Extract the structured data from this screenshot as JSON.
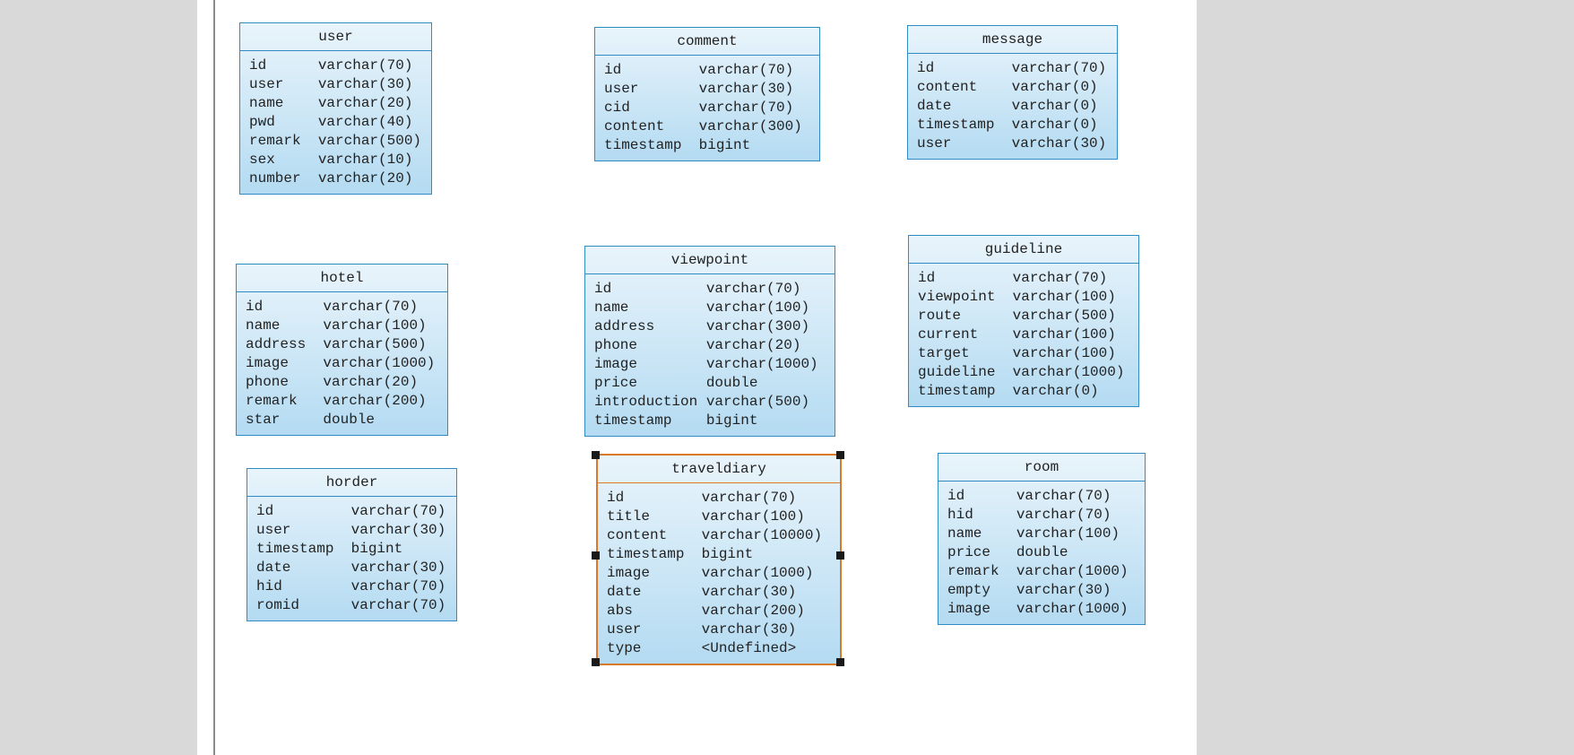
{
  "entities": {
    "user": {
      "title": "user",
      "nameW": 8,
      "rows": [
        {
          "name": "id",
          "type": "varchar(70)"
        },
        {
          "name": "user",
          "type": "varchar(30)"
        },
        {
          "name": "name",
          "type": "varchar(20)"
        },
        {
          "name": "pwd",
          "type": "varchar(40)"
        },
        {
          "name": "remark",
          "type": "varchar(500)"
        },
        {
          "name": "sex",
          "type": "varchar(10)"
        },
        {
          "name": "number",
          "type": "varchar(20)"
        }
      ]
    },
    "comment": {
      "title": "comment",
      "nameW": 11,
      "rows": [
        {
          "name": "id",
          "type": "varchar(70)"
        },
        {
          "name": "user",
          "type": "varchar(30)"
        },
        {
          "name": "cid",
          "type": "varchar(70)"
        },
        {
          "name": "content",
          "type": "varchar(300)"
        },
        {
          "name": "timestamp",
          "type": "bigint"
        }
      ]
    },
    "message": {
      "title": "message",
      "nameW": 11,
      "rows": [
        {
          "name": "id",
          "type": "varchar(70)"
        },
        {
          "name": "content",
          "type": "varchar(0)"
        },
        {
          "name": "date",
          "type": "varchar(0)"
        },
        {
          "name": "timestamp",
          "type": "varchar(0)"
        },
        {
          "name": "user",
          "type": "varchar(30)"
        }
      ]
    },
    "hotel": {
      "title": "hotel",
      "nameW": 9,
      "rows": [
        {
          "name": "id",
          "type": "varchar(70)"
        },
        {
          "name": "name",
          "type": "varchar(100)"
        },
        {
          "name": "address",
          "type": "varchar(500)"
        },
        {
          "name": "image",
          "type": "varchar(1000)"
        },
        {
          "name": "phone",
          "type": "varchar(20)"
        },
        {
          "name": "remark",
          "type": "varchar(200)"
        },
        {
          "name": "star",
          "type": "double"
        }
      ]
    },
    "viewpoint": {
      "title": "viewpoint",
      "nameW": 13,
      "rows": [
        {
          "name": "id",
          "type": "varchar(70)"
        },
        {
          "name": "name",
          "type": "varchar(100)"
        },
        {
          "name": "address",
          "type": "varchar(300)"
        },
        {
          "name": "phone",
          "type": "varchar(20)"
        },
        {
          "name": "image",
          "type": "varchar(1000)"
        },
        {
          "name": "price",
          "type": "double"
        },
        {
          "name": "introduction",
          "type": "varchar(500)"
        },
        {
          "name": "timestamp",
          "type": "bigint"
        }
      ]
    },
    "guideline": {
      "title": "guideline",
      "nameW": 11,
      "rows": [
        {
          "name": "id",
          "type": "varchar(70)"
        },
        {
          "name": "viewpoint",
          "type": "varchar(100)"
        },
        {
          "name": "route",
          "type": "varchar(500)"
        },
        {
          "name": "current",
          "type": "varchar(100)"
        },
        {
          "name": "target",
          "type": "varchar(100)"
        },
        {
          "name": "guideline",
          "type": "varchar(1000)"
        },
        {
          "name": "timestamp",
          "type": "varchar(0)"
        }
      ]
    },
    "horder": {
      "title": "horder",
      "nameW": 11,
      "rows": [
        {
          "name": "id",
          "type": "varchar(70)"
        },
        {
          "name": "user",
          "type": "varchar(30)"
        },
        {
          "name": "timestamp",
          "type": "bigint"
        },
        {
          "name": "date",
          "type": "varchar(30)"
        },
        {
          "name": "hid",
          "type": "varchar(70)"
        },
        {
          "name": "romid",
          "type": "varchar(70)"
        }
      ]
    },
    "traveldiary": {
      "title": "traveldiary",
      "nameW": 11,
      "rows": [
        {
          "name": "id",
          "type": "varchar(70)"
        },
        {
          "name": "title",
          "type": "varchar(100)"
        },
        {
          "name": "content",
          "type": "varchar(10000)"
        },
        {
          "name": "timestamp",
          "type": "bigint"
        },
        {
          "name": "image",
          "type": "varchar(1000)"
        },
        {
          "name": "date",
          "type": "varchar(30)"
        },
        {
          "name": "abs",
          "type": "varchar(200)"
        },
        {
          "name": "user",
          "type": "varchar(30)"
        },
        {
          "name": "type",
          "type": "<Undefined>"
        }
      ]
    },
    "room": {
      "title": "room",
      "nameW": 8,
      "rows": [
        {
          "name": "id",
          "type": "varchar(70)"
        },
        {
          "name": "hid",
          "type": "varchar(70)"
        },
        {
          "name": "name",
          "type": "varchar(100)"
        },
        {
          "name": "price",
          "type": "double"
        },
        {
          "name": "remark",
          "type": "varchar(1000)"
        },
        {
          "name": "empty",
          "type": "varchar(30)"
        },
        {
          "name": "image",
          "type": "varchar(1000)"
        }
      ]
    }
  },
  "selected": "traveldiary"
}
